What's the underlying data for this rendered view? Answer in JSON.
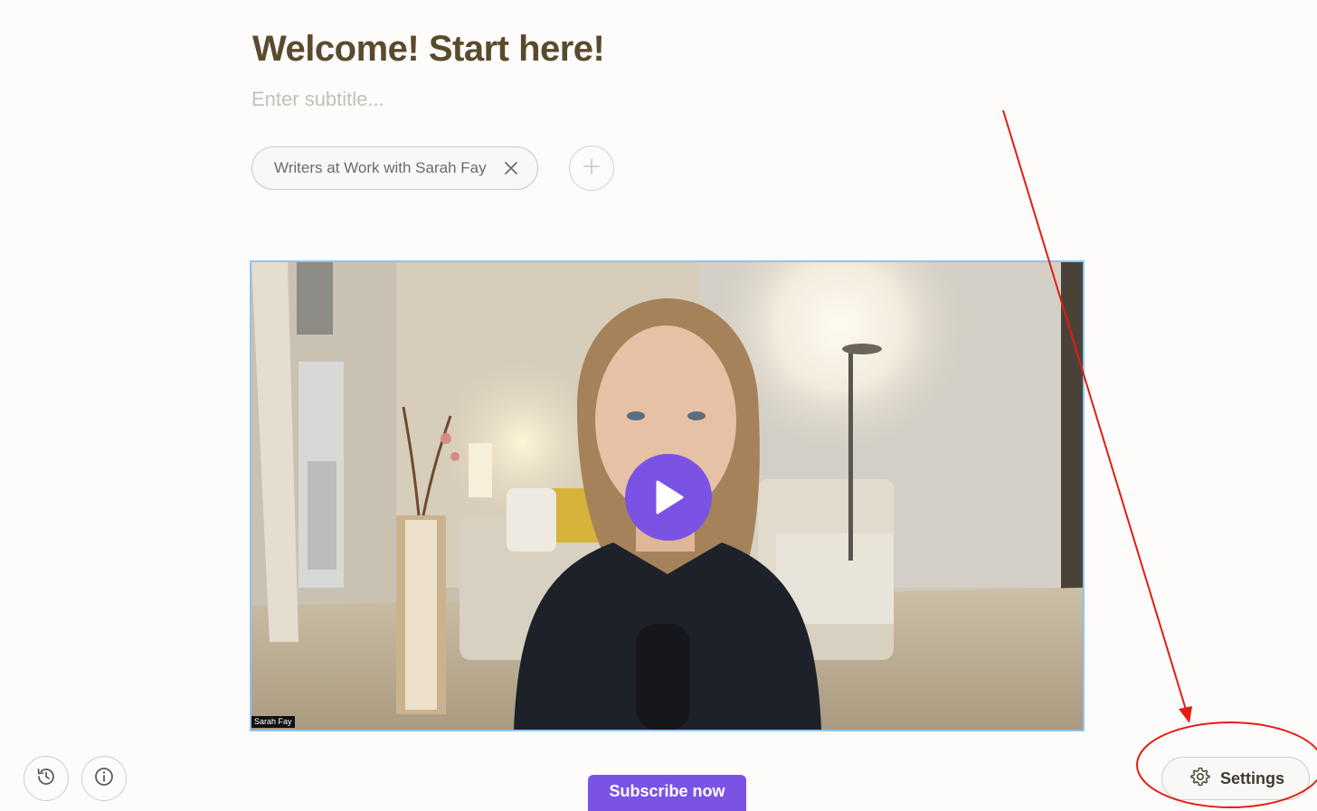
{
  "post": {
    "title": "Welcome! Start here!",
    "subtitle_placeholder": "Enter subtitle..."
  },
  "tags": {
    "items": [
      {
        "label": "Writers at Work with Sarah Fay"
      }
    ],
    "remove_icon": "close-icon",
    "add_icon": "plus-icon"
  },
  "video": {
    "speaker_name": "Sarah Fay",
    "play_icon": "play-icon",
    "play_button_color": "#7b53e4",
    "selected_border_color": "#8ec5f0"
  },
  "toolbar": {
    "history_icon": "history-icon",
    "info_icon": "info-icon",
    "subscribe_label": "Subscribe now",
    "settings_label": "Settings",
    "settings_icon": "gear-icon"
  },
  "annotation": {
    "color": "#e31d12",
    "shapes": [
      "arrow",
      "ellipse"
    ]
  },
  "colors": {
    "accent": "#7b53e4",
    "title": "#5a4a2e",
    "background": "#fdfcfb"
  }
}
